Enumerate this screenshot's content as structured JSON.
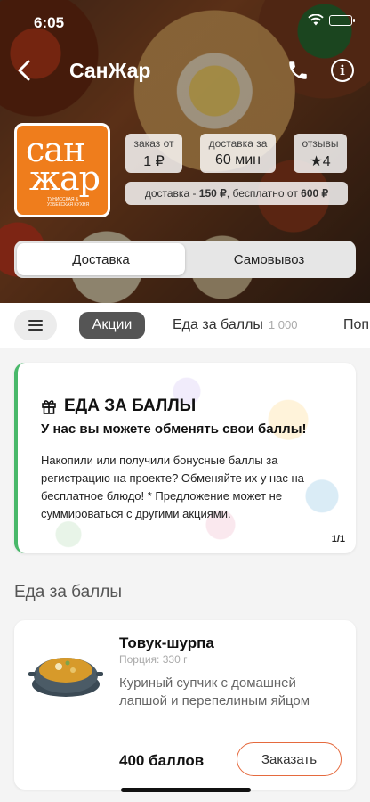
{
  "status": {
    "time": "6:05"
  },
  "header": {
    "title": "СанЖар"
  },
  "logo": {
    "line1": "сан",
    "line2": "жар",
    "subtitle": "ТУНИССКАЯ & УЗБЕКСКАЯ КУХНЯ"
  },
  "info": {
    "order_label": "заказ от",
    "order_value": "1 ₽",
    "delivery_label": "доставка за",
    "delivery_value": "60 мин",
    "reviews_label": "отзывы",
    "reviews_value": "★4",
    "delivery_price_prefix": "доставка - ",
    "delivery_price": "150 ₽",
    "delivery_free_prefix": ", бесплатно от ",
    "delivery_free": "600 ₽"
  },
  "segment": {
    "delivery": "Доставка",
    "pickup": "Самовывоз",
    "active": "delivery"
  },
  "categories": {
    "items": [
      {
        "label": "Акции"
      },
      {
        "label": "Еда за баллы",
        "count": "1 000"
      },
      {
        "label": "Поп"
      }
    ]
  },
  "promo": {
    "title": "ЕДА ЗА БАЛЛЫ",
    "subtitle": "У нас вы можете обменять свои баллы!",
    "text": "Накопили или получили бонусные баллы за регистрацию на проекте? Обменяйте их у нас на бесплатное блюдо! * Предложение может не суммироваться с другими акциями.",
    "page": "1/1"
  },
  "section": {
    "title": "Еда за баллы"
  },
  "dish": {
    "name": "Товук-шурпа",
    "portion": "Порция: 330 г",
    "description": "Куриный супчик с домашней лапшой и перепелиным яйцом",
    "price": "400 баллов",
    "order_label": "Заказать"
  },
  "colors": {
    "accent": "#e56a3e",
    "brand": "#ef7d1c",
    "promo_border": "#49b86a"
  }
}
